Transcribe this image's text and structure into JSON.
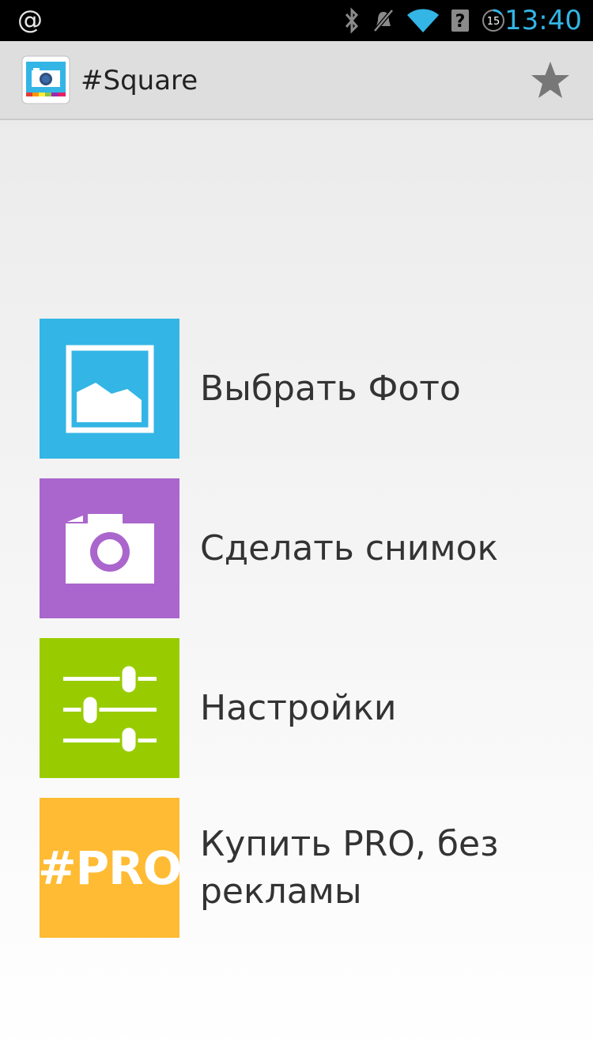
{
  "status_bar": {
    "notification_symbol": "@",
    "battery_level": "15",
    "time": "13:40",
    "icons": [
      "bluetooth-icon",
      "muted-icon",
      "wifi-icon",
      "no-signal-icon",
      "battery-icon"
    ]
  },
  "action_bar": {
    "title": "#Square",
    "icons": [
      "app-icon",
      "star-icon"
    ]
  },
  "menu": {
    "items": [
      {
        "label": "Выбрать Фото",
        "icon": "picture-icon",
        "color": "#33b5e5"
      },
      {
        "label": "Сделать снимок",
        "icon": "camera-icon",
        "color": "#aa66cc"
      },
      {
        "label": "Настройки",
        "icon": "sliders-icon",
        "color": "#99cc00"
      },
      {
        "label": "Купить PRO, без рекламы",
        "icon": "pro-badge",
        "tile_text": "#PRO",
        "color": "#ffbb33"
      }
    ]
  },
  "colors": {
    "accent": "#33b5e5",
    "status_bar": "#000000",
    "action_bar": "#dedede",
    "text": "#333333"
  }
}
